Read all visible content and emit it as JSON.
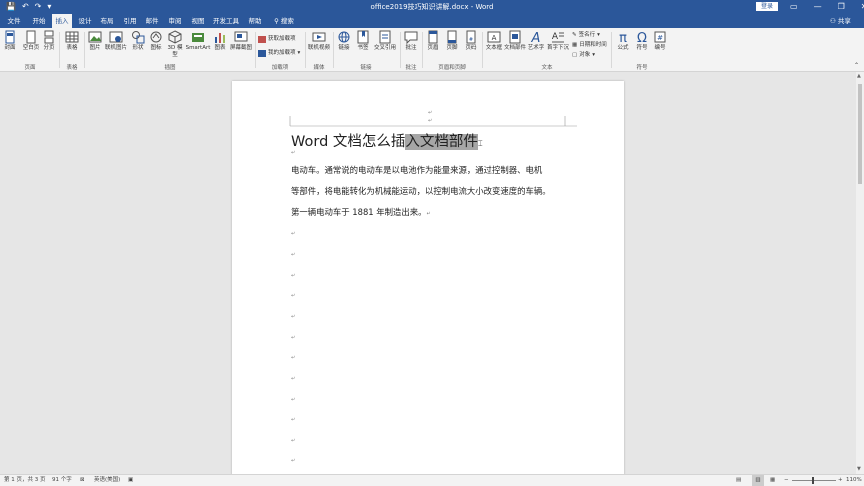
{
  "titlebar": {
    "quick_access": [
      "💾",
      "↶",
      "↷",
      "▾"
    ],
    "document_title": "office2019技巧知识讲解.docx - Word",
    "login_label": "登录",
    "window_buttons": [
      "▭",
      "—",
      "❐",
      "✕"
    ]
  },
  "tabs": [
    {
      "label": "文件"
    },
    {
      "label": "开始"
    },
    {
      "label": "插入"
    },
    {
      "label": "设计"
    },
    {
      "label": "布局"
    },
    {
      "label": "引用"
    },
    {
      "label": "邮件"
    },
    {
      "label": "审阅"
    },
    {
      "label": "视图"
    },
    {
      "label": "开发工具"
    },
    {
      "label": "帮助"
    },
    {
      "label": "搜索"
    }
  ],
  "share_label": "共享",
  "ribbon": {
    "buttons": [
      {
        "label": "封面"
      },
      {
        "label": "空白页"
      },
      {
        "label": "分页"
      },
      {
        "label": "表格"
      },
      {
        "label": "图片"
      },
      {
        "label": "联机图片"
      },
      {
        "label": "形状"
      },
      {
        "label": "图标"
      },
      {
        "label": "3D 模型"
      },
      {
        "label": "SmartArt"
      },
      {
        "label": "图表"
      },
      {
        "label": "屏幕截图"
      },
      {
        "label": "联机视频"
      },
      {
        "label": "链接"
      },
      {
        "label": "书签"
      },
      {
        "label": "交叉引用"
      },
      {
        "label": "批注"
      },
      {
        "label": "页眉"
      },
      {
        "label": "页脚"
      },
      {
        "label": "页码"
      },
      {
        "label": "文本框"
      },
      {
        "label": "文档部件"
      },
      {
        "label": "艺术字"
      },
      {
        "label": "首字下沉"
      },
      {
        "label": "公式"
      },
      {
        "label": "符号"
      },
      {
        "label": "编号"
      }
    ],
    "addins": [
      "获取加载项",
      "我的加载项"
    ],
    "text_small": [
      "签名行",
      "日期和时间",
      "对象"
    ],
    "groups": [
      "页面",
      "表格",
      "插图",
      "加载项",
      "媒体",
      "链接",
      "批注",
      "页眉和页脚",
      "文本",
      "符号"
    ]
  },
  "document": {
    "heading_plain": "Word 文档怎么插",
    "heading_selected": "入文档部件",
    "paragraph_mark": "↵",
    "paragraphs": [
      "电动车。通常说的电动车是以电池作为能量来源，通过控制器、电机",
      "等部件，将电能转化为机械能运动，以控制电流大小改变速度的车辆。",
      "第一辆电动车于 1881 年制造出来。"
    ]
  },
  "statusbar": {
    "page": "第 1 页，共 3 页",
    "words": "91 个字",
    "language": "英语(美国)",
    "zoom": "110%"
  },
  "colors": {
    "accent": "#2b579a",
    "selection": "#a6a6a6"
  }
}
